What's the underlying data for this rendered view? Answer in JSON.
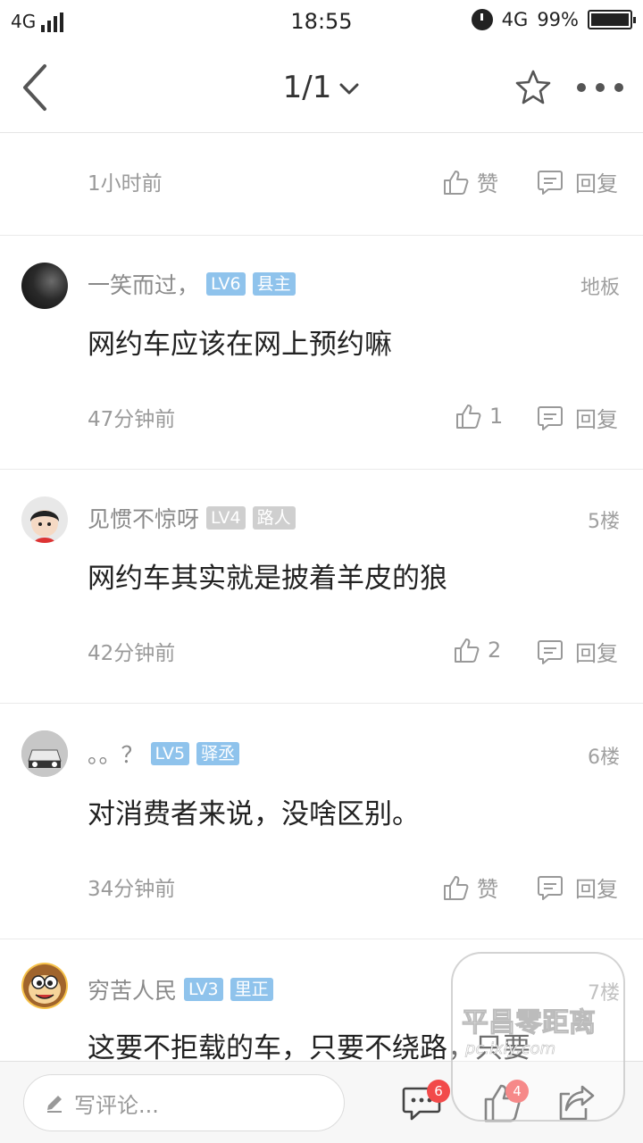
{
  "status_bar": {
    "network_left": "4G",
    "time": "18:55",
    "network_right": "4G",
    "battery": "99%",
    "icons": [
      "signal-icon",
      "alarm-icon",
      "battery-icon"
    ]
  },
  "nav": {
    "page_indicator": "1/1",
    "icons": [
      "back-icon",
      "chevron-down-icon",
      "star-icon",
      "more-icon"
    ]
  },
  "top_partial": {
    "time": "1小时前",
    "like_label": "赞",
    "reply_label": "回复"
  },
  "comments": [
    {
      "name": "一笑而过，",
      "level": "LV6",
      "title": "县主",
      "floor": "地板",
      "text": "网约车应该在网上预约嘛",
      "time": "47分钟前",
      "like": "1",
      "reply": "回复"
    },
    {
      "name": "见惯不惊呀",
      "level": "LV4",
      "title": "路人",
      "floor": "5楼",
      "text": "网约车其实就是披着羊皮的狼",
      "time": "42分钟前",
      "like": "2",
      "reply": "回复"
    },
    {
      "name": "。。？",
      "level": "LV5",
      "title": "驿丞",
      "floor": "6楼",
      "text": "对消费者来说，没啥区别。",
      "time": "34分钟前",
      "like": "赞",
      "reply": "回复"
    },
    {
      "name": "穷苦人民",
      "level": "LV3",
      "title": "里正",
      "floor": "7楼",
      "text": "这要不拒载的车，只要不绕路，只要"
    }
  ],
  "bottom_bar": {
    "placeholder": "写评论...",
    "comment_count": "6",
    "like_count": "4",
    "icons": [
      "pencil-icon",
      "comments-icon",
      "thumbs-up-icon",
      "share-icon"
    ]
  },
  "watermark": {
    "text": "平昌零距离",
    "sub": "pc.ixiy.com"
  },
  "colors": {
    "level_badge": "#8fc3ec",
    "level_badge_gray": "#cfcfcf",
    "badge_red": "#f24a4a"
  }
}
